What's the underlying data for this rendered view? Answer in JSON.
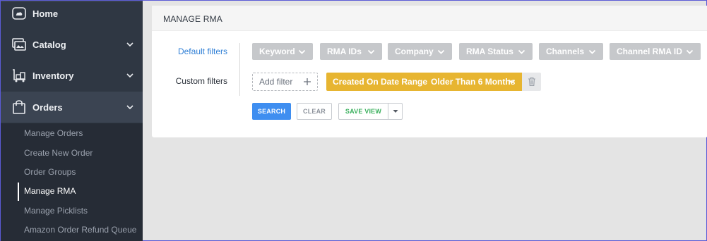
{
  "sidebar": {
    "items": [
      {
        "label": "Home",
        "icon": "home-icon"
      },
      {
        "label": "Catalog",
        "icon": "catalog-icon"
      },
      {
        "label": "Inventory",
        "icon": "inventory-icon"
      },
      {
        "label": "Orders",
        "icon": "orders-bag-icon"
      }
    ],
    "orders_sub": [
      {
        "label": "Manage Orders"
      },
      {
        "label": "Create New Order"
      },
      {
        "label": "Order Groups"
      },
      {
        "label": "Manage RMA"
      },
      {
        "label": "Manage Picklists"
      },
      {
        "label": "Amazon Order Refund Queue"
      }
    ]
  },
  "panel": {
    "title": "MANAGE RMA",
    "default_filters_label": "Default filters",
    "custom_filters_label": "Custom filters",
    "default_filters": [
      {
        "label": "Keyword"
      },
      {
        "label": "RMA IDs"
      },
      {
        "label": "Company"
      },
      {
        "label": "RMA Status"
      },
      {
        "label": "Channels"
      },
      {
        "label": "Channel RMA ID"
      }
    ],
    "add_filter_label": "Add filter",
    "custom_filter": {
      "name": "Created On Date Range",
      "value": "Older Than 6 Months"
    },
    "buttons": {
      "search": "SEARCH",
      "clear": "CLEAR",
      "save_view": "SAVE VIEW"
    }
  },
  "colors": {
    "sidebar_bg": "#2f3743",
    "accent_blue": "#3f8ef0",
    "chip_yellow": "#e7b531",
    "save_green": "#3bb05e",
    "pill_gray": "#c6c8cb"
  }
}
